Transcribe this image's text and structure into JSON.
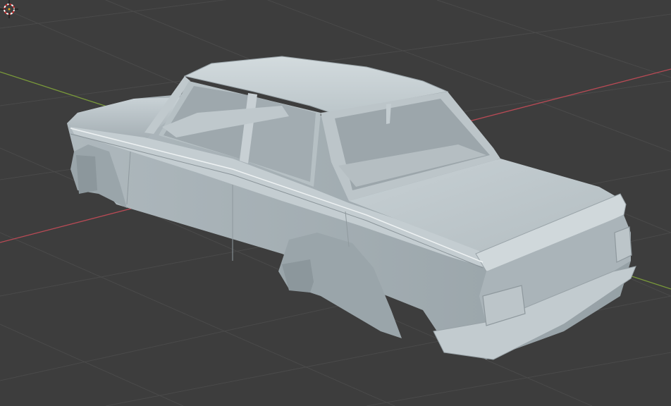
{
  "viewport": {
    "background": "#3d3d3d",
    "grid_color": "#4a4a4a",
    "x_axis_color": "#b84a55",
    "y_axis_color": "#7a9a3a"
  },
  "object": {
    "type": "car-body-mesh",
    "color": "#b9c3c7",
    "shading": "solid"
  },
  "cursor": {
    "icon": "3d-cursor-icon"
  }
}
